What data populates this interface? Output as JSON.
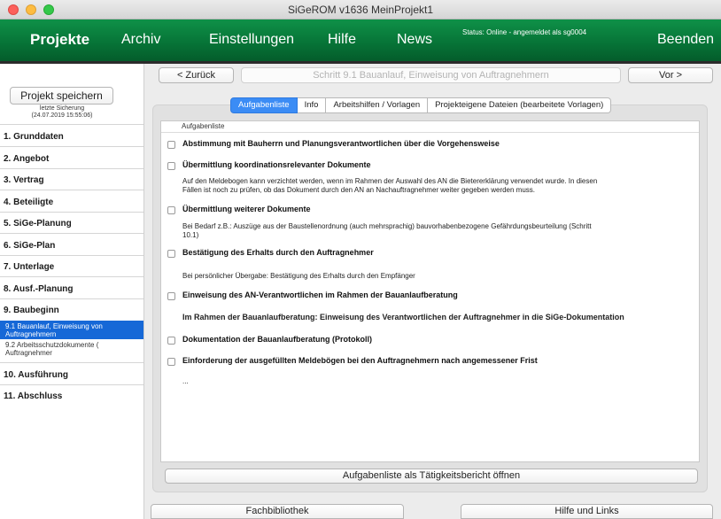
{
  "window": {
    "title": "SiGeROM  v1636   MeinProjekt1"
  },
  "nav": {
    "projekte": "Projekte",
    "archiv": "Archiv",
    "einstellungen": "Einstellungen",
    "hilfe": "Hilfe",
    "news": "News",
    "status": "Status: Online - angemeldet als sg0004",
    "beenden": "Beenden"
  },
  "sidebar": {
    "save_label": "Projekt speichern",
    "last_save_label": "letzte Sicherung",
    "last_save_time": "(24.07.2019 15:55:06)",
    "items": [
      "1.  Grunddaten",
      "2.  Angebot",
      "3.  Vertrag",
      "4.  Beteiligte",
      "5.  SiGe-Planung",
      "6.  SiGe-Plan",
      "7.  Unterlage",
      "8.  Ausf.-Planung",
      "9.  Baubeginn",
      "10. Ausführung",
      "11. Abschluss"
    ],
    "subitems": [
      {
        "line1": "9.1 Bauanlauf, Einweisung von",
        "line2": "Auftragnehmern"
      },
      {
        "line1": "9.2 Arbeitsschutzdokumente (",
        "line2": "Auftragnehmer"
      }
    ]
  },
  "stepnav": {
    "back": "< Zurück",
    "step_title": "Schritt 9.1  Bauanlauf, Einweisung von Auftragnehmern",
    "next": "Vor >"
  },
  "tabs": [
    "Aufgabenliste",
    "Info",
    "Arbeitshilfen / Vorlagen",
    "Projekteigene Dateien (bearbeitete Vorlagen)"
  ],
  "list": {
    "header": "Aufgabenliste",
    "tasks": [
      "Abstimmung mit Bauherrn und Planungsverantwortlichen über die Vorgehensweise",
      "Übermittlung koordinationsrelevanter Dokumente",
      "Übermittlung weiterer Dokumente",
      "Bestätigung des Erhalts durch den Auftragnehmer",
      "Einweisung des AN-Verantwortlichen im Rahmen der Bauanlaufberatung",
      "Dokumentation der Bauanlaufberatung (Protokoll)",
      "Einforderung der ausgefüllten Meldebögen bei den Auftragnehmern nach angemessener Frist"
    ],
    "desc1_line1": "Auf den Meldebogen kann verzichtet werden, wenn im Rahmen der Auswahl des AN die Bietererklärung verwendet wurde. In diesen",
    "desc1_line2": "Fällen ist noch zu prüfen, ob das Dokument durch den AN an Nachauftragnehmer weiter gegeben werden muss.",
    "desc2_line1": "Bei Bedarf z.B.: Auszüge aus der Baustellenordnung (auch mehrsprachig) bauvorhabenbezogene Gefährdungsbeurteilung (Schritt",
    "desc2_line2": "10.1)",
    "desc3": "Bei persönlicher Übergabe: Bestätigung des Erhalts durch den Empfänger",
    "desc4": "Im Rahmen der Bauanlaufberatung: Einweisung des Verantwortlichen der Auftragnehmer in die SiGe-Dokumentation",
    "ellipsis": "..."
  },
  "buttons": {
    "report": "Aufgabenliste als Tätigkeitsbericht öffnen",
    "fachbibliothek": "Fachbibliothek",
    "hilfe_links": "Hilfe und Links"
  }
}
